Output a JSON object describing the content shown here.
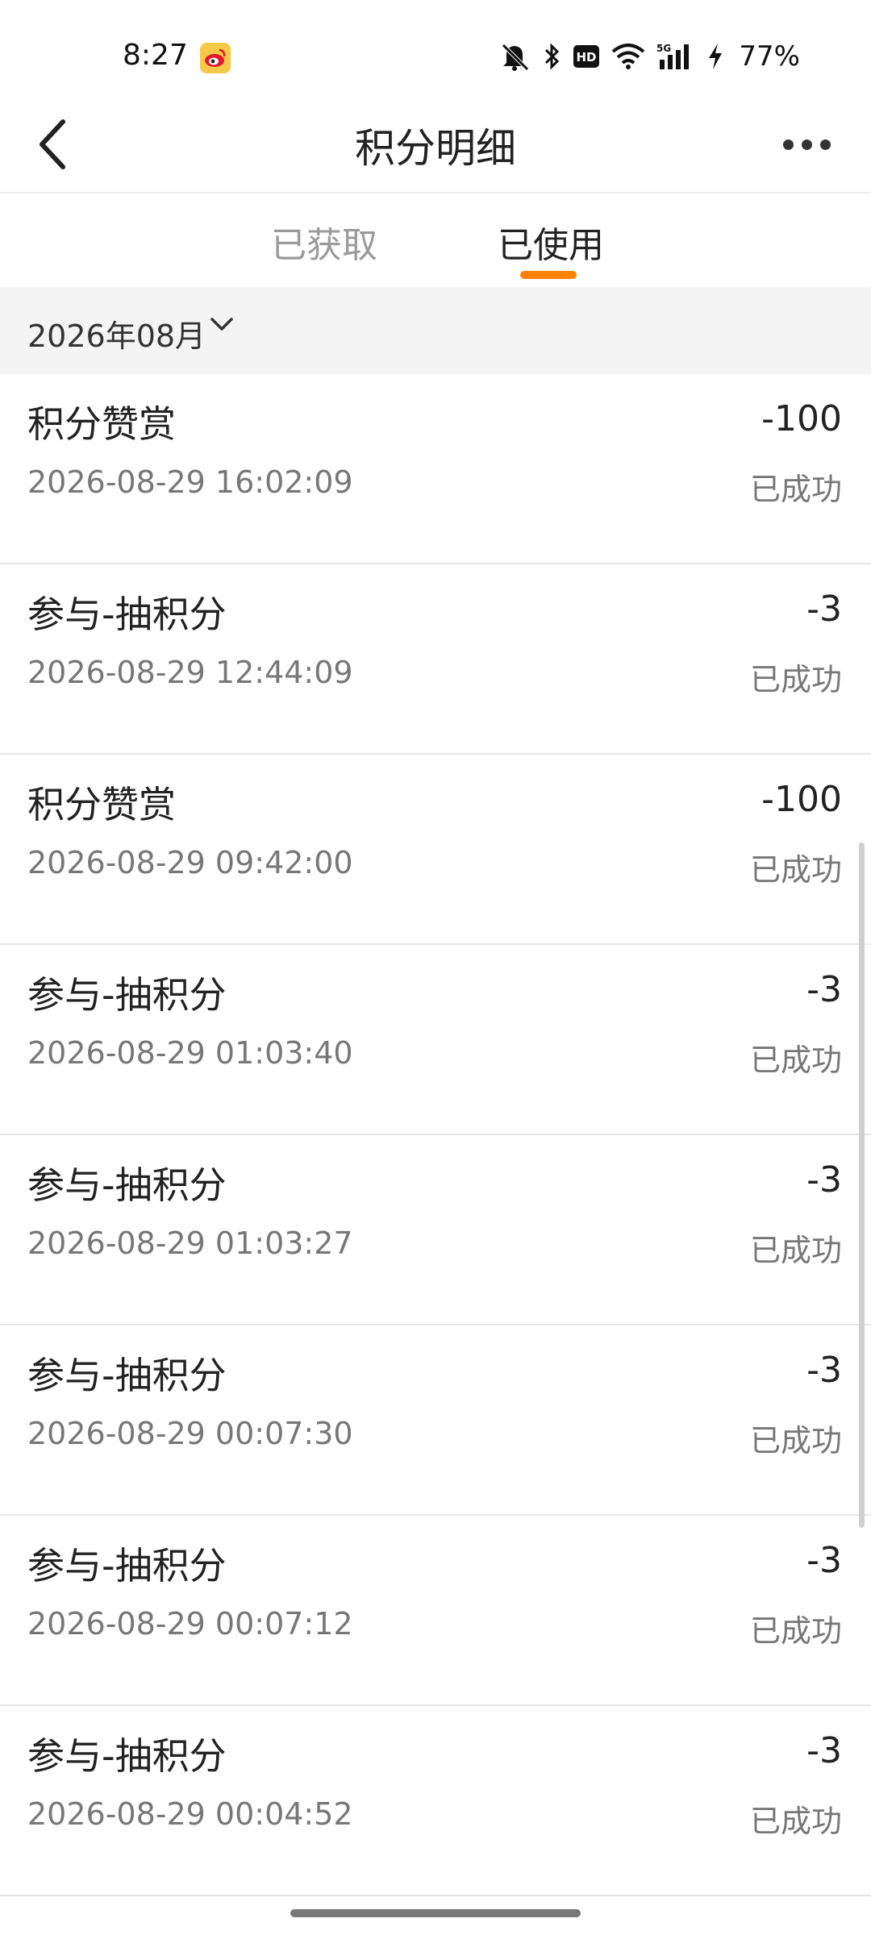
{
  "status_bar": {
    "time": "8:27",
    "battery": "77%",
    "icons": [
      "weibo-app-icon",
      "mute-icon",
      "bluetooth-icon",
      "hd-icon",
      "wifi-icon",
      "5g-signal-icon",
      "charging-icon"
    ]
  },
  "nav": {
    "title": "积分明细"
  },
  "tabs": [
    {
      "label": "已获取",
      "active": false
    },
    {
      "label": "已使用",
      "active": true
    }
  ],
  "month_filter": {
    "label": "2026年08月"
  },
  "records": [
    {
      "title": "积分赞赏",
      "time": "2026-08-29 16:02:09",
      "amount": "-100",
      "status": "已成功"
    },
    {
      "title": "参与-抽积分",
      "time": "2026-08-29 12:44:09",
      "amount": "-3",
      "status": "已成功"
    },
    {
      "title": "积分赞赏",
      "time": "2026-08-29 09:42:00",
      "amount": "-100",
      "status": "已成功"
    },
    {
      "title": "参与-抽积分",
      "time": "2026-08-29 01:03:40",
      "amount": "-3",
      "status": "已成功"
    },
    {
      "title": "参与-抽积分",
      "time": "2026-08-29 01:03:27",
      "amount": "-3",
      "status": "已成功"
    },
    {
      "title": "参与-抽积分",
      "time": "2026-08-29 00:07:30",
      "amount": "-3",
      "status": "已成功"
    },
    {
      "title": "参与-抽积分",
      "time": "2026-08-29 00:07:12",
      "amount": "-3",
      "status": "已成功"
    },
    {
      "title": "参与-抽积分",
      "time": "2026-08-29 00:04:52",
      "amount": "-3",
      "status": "已成功"
    }
  ],
  "colors": {
    "accent": "#ff8200",
    "inactive_tab": "#9a9a9a",
    "secondary_text": "#777777"
  }
}
